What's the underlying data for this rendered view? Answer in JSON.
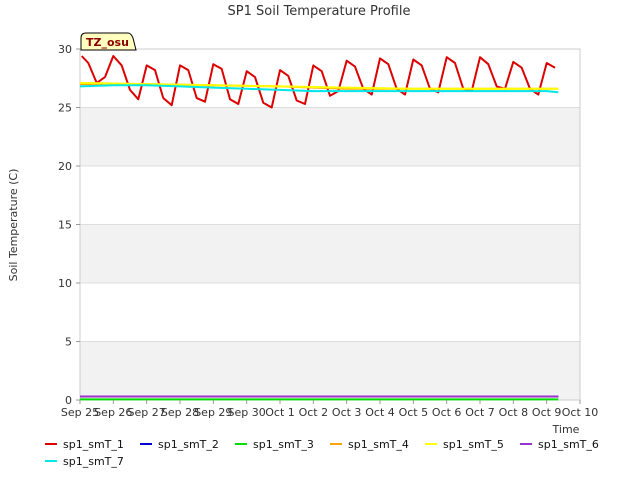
{
  "chart_data": {
    "type": "line",
    "title": "SP1 Soil Temperature Profile",
    "xlabel": "Time",
    "ylabel": "Soil Temperature (C)",
    "badge": "TZ_osu",
    "ylim": [
      0,
      30
    ],
    "yticks": [
      0,
      5,
      10,
      15,
      20,
      25,
      30
    ],
    "xlim": [
      0,
      15
    ],
    "xticks": [
      {
        "x": 0,
        "label": "Sep 25"
      },
      {
        "x": 1,
        "label": "Sep 26"
      },
      {
        "x": 2,
        "label": "Sep 27"
      },
      {
        "x": 3,
        "label": "Sep 28"
      },
      {
        "x": 4,
        "label": "Sep 29"
      },
      {
        "x": 5,
        "label": "Sep 30"
      },
      {
        "x": 6,
        "label": "Oct 1"
      },
      {
        "x": 7,
        "label": "Oct 2"
      },
      {
        "x": 8,
        "label": "Oct 3"
      },
      {
        "x": 9,
        "label": "Oct 4"
      },
      {
        "x": 10,
        "label": "Oct 5"
      },
      {
        "x": 11,
        "label": "Oct 6"
      },
      {
        "x": 12,
        "label": "Oct 7"
      },
      {
        "x": 13,
        "label": "Oct 8"
      },
      {
        "x": 14,
        "label": "Oct 9"
      },
      {
        "x": 15,
        "label": "Oct 10"
      }
    ],
    "grid": true,
    "legend_position": "bottom",
    "series": [
      {
        "name": "sp1_smT_1",
        "color": "#dd0000",
        "x": [
          0.05,
          0.25,
          0.5,
          0.75,
          1.0,
          1.25,
          1.5,
          1.75,
          2.0,
          2.25,
          2.5,
          2.75,
          3.0,
          3.25,
          3.5,
          3.75,
          4.0,
          4.25,
          4.5,
          4.75,
          5.0,
          5.25,
          5.5,
          5.75,
          6.0,
          6.25,
          6.5,
          6.75,
          7.0,
          7.25,
          7.5,
          7.75,
          8.0,
          8.25,
          8.5,
          8.75,
          9.0,
          9.25,
          9.5,
          9.75,
          10.0,
          10.25,
          10.5,
          10.75,
          11.0,
          11.25,
          11.5,
          11.75,
          12.0,
          12.25,
          12.5,
          12.75,
          13.0,
          13.25,
          13.5,
          13.75,
          14.0,
          14.25
        ],
        "y": [
          29.4,
          28.8,
          27.1,
          27.6,
          29.4,
          28.6,
          26.5,
          25.7,
          28.6,
          28.2,
          25.8,
          25.2,
          28.6,
          28.2,
          25.8,
          25.5,
          28.7,
          28.3,
          25.7,
          25.3,
          28.1,
          27.6,
          25.4,
          25.0,
          28.2,
          27.7,
          25.6,
          25.3,
          28.6,
          28.1,
          26.0,
          26.4,
          29.0,
          28.5,
          26.6,
          26.1,
          29.2,
          28.7,
          26.6,
          26.1,
          29.1,
          28.6,
          26.6,
          26.3,
          29.3,
          28.8,
          26.6,
          26.4,
          29.3,
          28.7,
          26.8,
          26.6,
          28.9,
          28.4,
          26.6,
          26.1,
          28.8,
          28.4
        ]
      },
      {
        "name": "sp1_smT_2",
        "color": "#0000cc",
        "x": [
          0.0,
          14.35
        ],
        "y": [
          0.3,
          0.3
        ]
      },
      {
        "name": "sp1_smT_3",
        "color": "#00dd00",
        "x": [
          0.0,
          14.35
        ],
        "y": [
          0.05,
          0.05
        ]
      },
      {
        "name": "sp1_smT_4",
        "color": "#ffa500",
        "x": [
          0.0,
          2.0,
          4.0,
          6.0,
          8.0,
          10.0,
          12.0,
          14.35
        ],
        "y": [
          27.0,
          27.0,
          26.9,
          26.8,
          26.6,
          26.6,
          26.6,
          26.6
        ]
      },
      {
        "name": "sp1_smT_5",
        "color": "#ffff00",
        "x": [
          0.0,
          2.0,
          4.0,
          6.0,
          8.0,
          10.0,
          12.0,
          14.35
        ],
        "y": [
          27.1,
          27.0,
          26.9,
          26.8,
          26.7,
          26.6,
          26.6,
          26.6
        ]
      },
      {
        "name": "sp1_smT_6",
        "color": "#9933cc",
        "x": [
          0.0,
          14.35
        ],
        "y": [
          0.3,
          0.3
        ]
      },
      {
        "name": "sp1_smT_7",
        "color": "#00e5e5",
        "x": [
          0.0,
          1.0,
          2.0,
          3.0,
          4.0,
          5.0,
          6.0,
          7.0,
          8.0,
          9.0,
          10.0,
          11.0,
          12.0,
          13.0,
          14.0,
          14.35
        ],
        "y": [
          26.8,
          26.9,
          26.9,
          26.8,
          26.7,
          26.6,
          26.5,
          26.4,
          26.4,
          26.4,
          26.4,
          26.4,
          26.4,
          26.4,
          26.4,
          26.3
        ]
      }
    ]
  }
}
